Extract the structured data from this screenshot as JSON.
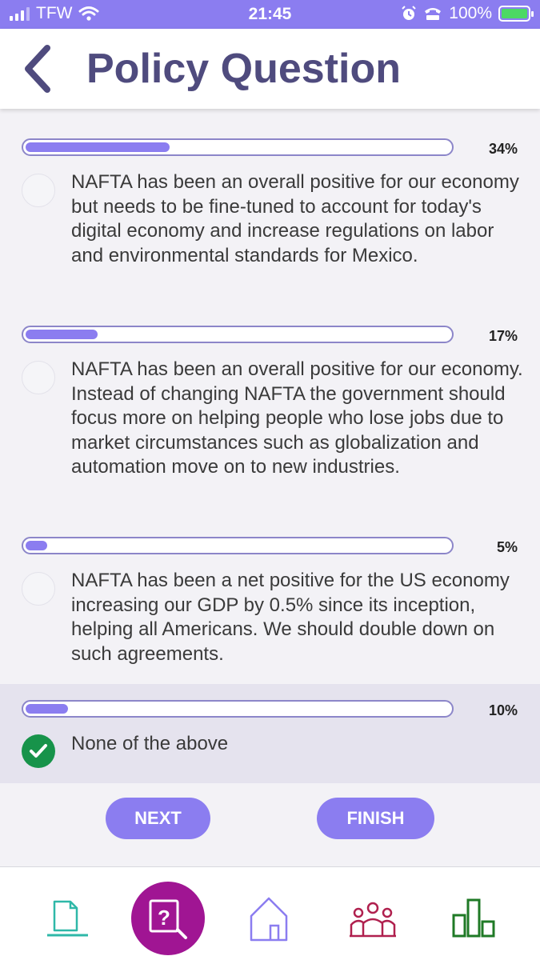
{
  "status_bar": {
    "carrier": "TFW",
    "time": "21:45",
    "battery": "100%",
    "icons": [
      "signal-icon",
      "wifi-icon",
      "alarm-icon",
      "tty-icon",
      "battery-charging-icon"
    ]
  },
  "header": {
    "title": "Policy Question",
    "back_icon": "chevron-left-icon"
  },
  "options": [
    {
      "percent_label": "34%",
      "percent": 34,
      "text": "NAFTA has been an overall positive for our economy but needs to be fine-tuned to account for today's digital economy and increase regulations on labor and environmental standards for Mexico.",
      "selected": false
    },
    {
      "percent_label": "17%",
      "percent": 17,
      "text": "NAFTA has been an overall positive for our economy. Instead of changing NAFTA the government should focus more on helping people who lose jobs due to market circumstances such as globalization and automation move on to new industries.",
      "selected": false
    },
    {
      "percent_label": "5%",
      "percent": 5,
      "text": "NAFTA has been a net positive for the US economy increasing our GDP by 0.5% since its inception, helping all Americans. We should double down on such agreements.",
      "selected": false
    },
    {
      "percent_label": "10%",
      "percent": 10,
      "text": "None of the above",
      "selected": true
    }
  ],
  "buttons": {
    "next": "NEXT",
    "finish": "FINISH"
  },
  "nav": {
    "items": [
      "document-icon",
      "question-search-icon",
      "home-icon",
      "people-icon",
      "bar-chart-icon"
    ],
    "active": "question-search-icon"
  },
  "colors": {
    "accent": "#8b7df0",
    "title": "#4f4b7e",
    "active_nav": "#a01593",
    "selected_check": "#17934a",
    "nav_document": "#2fb8a8",
    "nav_home": "#8b7df0",
    "nav_people": "#b0204e",
    "nav_chart": "#1f7a26"
  }
}
